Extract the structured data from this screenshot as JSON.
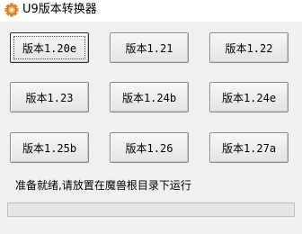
{
  "window": {
    "title": "U9版本转换器",
    "icon": "app-gear-icon"
  },
  "buttons": [
    {
      "label": "版本1.20e",
      "focused": true
    },
    {
      "label": "版本1.21"
    },
    {
      "label": "版本1.22"
    },
    {
      "label": "版本1.23"
    },
    {
      "label": "版本1.24b"
    },
    {
      "label": "版本1.24e"
    },
    {
      "label": "版本1.25b"
    },
    {
      "label": "版本1.26"
    },
    {
      "label": "版本1.27a"
    }
  ],
  "status": {
    "text": "准备就绪,请放置在魔兽根目录下运行"
  },
  "progress": {
    "value_percent": 0
  }
}
